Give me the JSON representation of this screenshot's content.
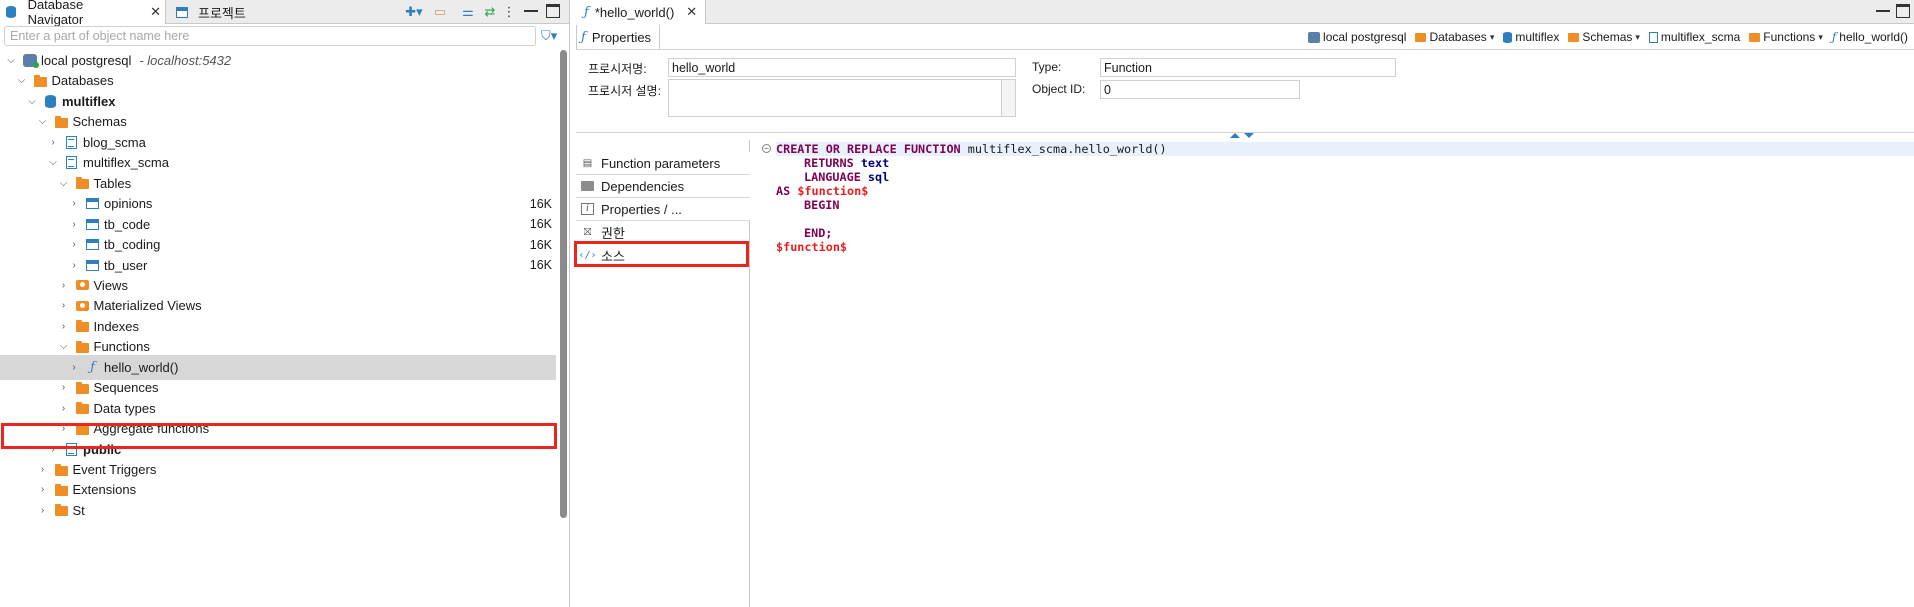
{
  "navigator": {
    "tab_label": "Database Navigator",
    "tab_close": "✕",
    "tab2_label": "프로젝트",
    "filter_placeholder": "Enter a part of object name here",
    "tree": [
      {
        "label": "local postgresql",
        "extra": "- localhost:5432",
        "icon": "connection",
        "level": 0,
        "expanded": true
      },
      {
        "label": "Databases",
        "icon": "folder",
        "level": 1,
        "expanded": true
      },
      {
        "label": "multiflex",
        "icon": "database",
        "level": 2,
        "expanded": true,
        "bold": true
      },
      {
        "label": "Schemas",
        "icon": "folder",
        "level": 3,
        "expanded": true
      },
      {
        "label": "blog_scma",
        "icon": "schema",
        "level": 4,
        "expanded": false
      },
      {
        "label": "multiflex_scma",
        "icon": "schema",
        "level": 4,
        "expanded": true
      },
      {
        "label": "Tables",
        "icon": "folder",
        "level": 5,
        "expanded": true
      },
      {
        "label": "opinions",
        "icon": "table",
        "level": 6,
        "expanded": false,
        "size": "16K"
      },
      {
        "label": "tb_code",
        "icon": "table",
        "level": 6,
        "expanded": false,
        "size": "16K"
      },
      {
        "label": "tb_coding",
        "icon": "table",
        "level": 6,
        "expanded": false,
        "size": "16K"
      },
      {
        "label": "tb_user",
        "icon": "table",
        "level": 6,
        "expanded": false,
        "size": "16K"
      },
      {
        "label": "Views",
        "icon": "view",
        "level": 5,
        "expanded": false
      },
      {
        "label": "Materialized Views",
        "icon": "view",
        "level": 5,
        "expanded": false
      },
      {
        "label": "Indexes",
        "icon": "folder",
        "level": 5,
        "expanded": false
      },
      {
        "label": "Functions",
        "icon": "folder",
        "level": 5,
        "expanded": true
      },
      {
        "label": "hello_world()",
        "icon": "function",
        "level": 6,
        "expanded": false,
        "selected": true
      },
      {
        "label": "Sequences",
        "icon": "folder",
        "level": 5,
        "expanded": false
      },
      {
        "label": "Data types",
        "icon": "folder",
        "level": 5,
        "expanded": false
      },
      {
        "label": "Aggregate functions",
        "icon": "folder",
        "level": 5,
        "expanded": false
      },
      {
        "label": "public",
        "icon": "schema",
        "level": 4,
        "expanded": false,
        "bold": true
      },
      {
        "label": "Event Triggers",
        "icon": "folder",
        "level": 3,
        "expanded": false
      },
      {
        "label": "Extensions",
        "icon": "folder",
        "level": 3,
        "expanded": false
      },
      {
        "label": "St",
        "icon": "folder",
        "level": 3,
        "expanded": false
      }
    ]
  },
  "editor": {
    "tab_label": "*hello_world()",
    "tab_close": "✕",
    "properties_tab": "Properties",
    "breadcrumbs": [
      {
        "label": "local postgresql",
        "icon": "connection",
        "dropdown": false
      },
      {
        "label": "Databases",
        "icon": "folder",
        "dropdown": true
      },
      {
        "label": "multiflex",
        "icon": "database",
        "dropdown": false
      },
      {
        "label": "Schemas",
        "icon": "folder",
        "dropdown": true
      },
      {
        "label": "multiflex_scma",
        "icon": "schema",
        "dropdown": false
      },
      {
        "label": "Functions",
        "icon": "folder",
        "dropdown": true
      },
      {
        "label": "hello_world()",
        "icon": "function",
        "dropdown": false
      }
    ],
    "fields": {
      "name_label": "프로시저명:",
      "name_value": "hello_world",
      "desc_label": "프로시저 설명:",
      "type_label": "Type:",
      "type_value": "Function",
      "objid_label": "Object ID:",
      "objid_value": "0"
    },
    "side_tabs": [
      "Function parameters",
      "Dependencies",
      "Properties / ...",
      "권한",
      "소스"
    ],
    "code": {
      "l1_kw": "CREATE OR REPLACE FUNCTION",
      "l1_id": " multiflex_scma.hello_world()",
      "l2_kw": "RETURNS",
      "l2_type": " text",
      "l3_kw": "LANGUAGE",
      "l3_lang": " sql",
      "l4_kw": "AS",
      "l4_str": " $function$",
      "l5_kw": "BEGIN",
      "l6_kw": "END;",
      "l7_str": "$function$"
    }
  }
}
